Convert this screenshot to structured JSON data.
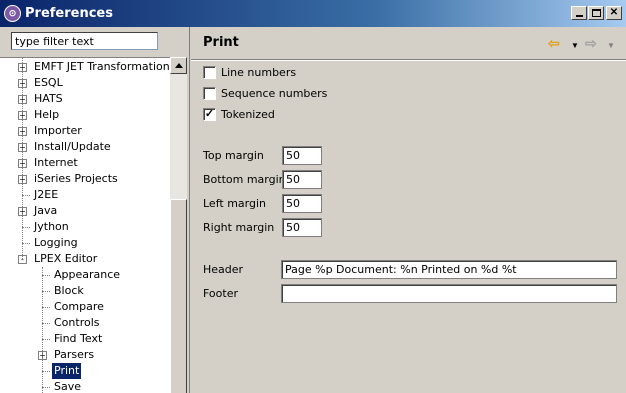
{
  "window": {
    "title": "Preferences",
    "icon": "eclipse-logo-icon",
    "controls": [
      "minimize",
      "maximize",
      "close"
    ]
  },
  "filter": {
    "value": "type filter text"
  },
  "tree": {
    "items": [
      {
        "label": "EMFT JET Transformations",
        "expander": "+",
        "level": 0
      },
      {
        "label": "ESQL",
        "expander": "+",
        "level": 0
      },
      {
        "label": "HATS",
        "expander": "+",
        "level": 0
      },
      {
        "label": "Help",
        "expander": "+",
        "level": 0
      },
      {
        "label": "Importer",
        "expander": "+",
        "level": 0
      },
      {
        "label": "Install/Update",
        "expander": "+",
        "level": 0
      },
      {
        "label": "Internet",
        "expander": "+",
        "level": 0
      },
      {
        "label": "iSeries Projects",
        "expander": "+",
        "level": 0
      },
      {
        "label": "J2EE",
        "expander": "",
        "level": 0
      },
      {
        "label": "Java",
        "expander": "+",
        "level": 0
      },
      {
        "label": "Jython",
        "expander": "",
        "level": 0
      },
      {
        "label": "Logging",
        "expander": "",
        "level": 0
      },
      {
        "label": "LPEX Editor",
        "expander": "-",
        "level": 0
      },
      {
        "label": "Appearance",
        "expander": "",
        "level": 1
      },
      {
        "label": "Block",
        "expander": "",
        "level": 1
      },
      {
        "label": "Compare",
        "expander": "",
        "level": 1
      },
      {
        "label": "Controls",
        "expander": "",
        "level": 1
      },
      {
        "label": "Find Text",
        "expander": "",
        "level": 1
      },
      {
        "label": "Parsers",
        "expander": "+",
        "level": 1
      },
      {
        "label": "Print",
        "expander": "",
        "level": 1,
        "selected": true
      },
      {
        "label": "Save",
        "expander": "",
        "level": 1
      }
    ]
  },
  "page": {
    "title": "Print",
    "checkboxes": [
      {
        "label": "Line numbers",
        "checked": false
      },
      {
        "label": "Sequence numbers",
        "checked": false
      },
      {
        "label": "Tokenized",
        "checked": true
      }
    ],
    "margins": [
      {
        "label": "Top margin",
        "value": "50"
      },
      {
        "label": "Bottom margin",
        "value": "50"
      },
      {
        "label": "Left margin",
        "value": "50"
      },
      {
        "label": "Right margin",
        "value": "50"
      }
    ],
    "header": {
      "label": "Header",
      "value": "Page %p   Document: %n  Printed on %d %t"
    },
    "footer": {
      "label": "Footer",
      "value": ""
    }
  },
  "colors": {
    "selection": "#0a246a",
    "titlebar_start": "#0a246a",
    "back_arrow": "#e0a020"
  }
}
